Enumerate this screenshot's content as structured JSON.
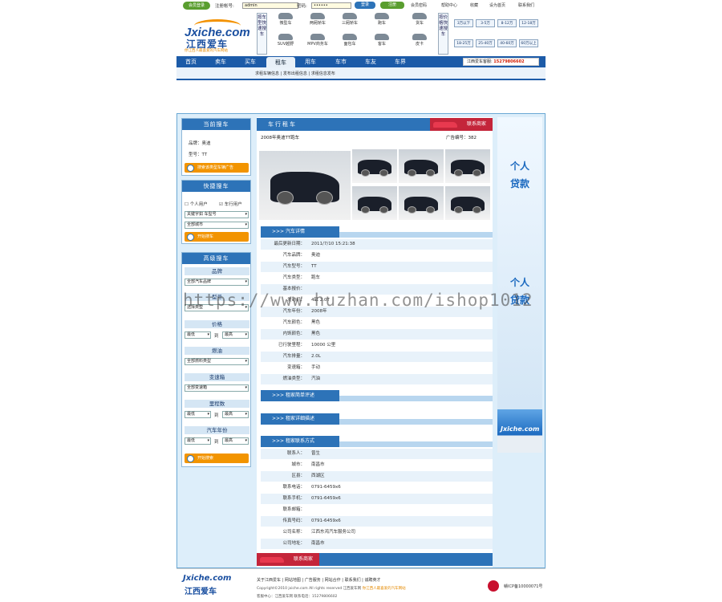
{
  "topbar": {
    "login_badge": "会员登录",
    "username_label": "注册帐号:",
    "username_value": "admin",
    "password_label": "密码:",
    "password_value": "••••••",
    "login_btn": "登录",
    "register_btn": "注册",
    "links": [
      "会员密码",
      "帮助中心",
      "收藏",
      "设为首页",
      "联系我们"
    ]
  },
  "header": {
    "logo_en": "Jxiche.com",
    "logo_cn": "江西爱车",
    "logo_sub": "你江西人最喜爱的汽车网站",
    "left_vtext": "按车型快速搜车",
    "right_vtext": "按价格快速搜车",
    "car_types": [
      "微型车",
      "两厢轿车",
      "三厢轿车",
      "跑车",
      "货车",
      "SUV越野",
      "MPV商务车",
      "面包车",
      "客车",
      "皮卡"
    ],
    "price_ranges": [
      "3万以下",
      "3-5万",
      "8-12万",
      "12-18万",
      "18-25万",
      "25-40万",
      "40-60万",
      "60万以上"
    ]
  },
  "nav": {
    "items": [
      "首页",
      "卖车",
      "买车",
      "租车",
      "用车",
      "车市",
      "车友",
      "车界"
    ],
    "active_index": 3,
    "hotline_label": "江西爱车客服:",
    "hotline_number": "15279806602"
  },
  "subnav": {
    "text": "求租车辆信息 | 发布出租信息 | 求租信息发布"
  },
  "sidebar": {
    "current": {
      "title": "当前搜车",
      "brand": "品牌：奥迪",
      "model": "型号：TT",
      "button": "搜索该类型车辆广告"
    },
    "quick": {
      "title": "快捷搜车",
      "opt1": "个人用户",
      "opt2": "车行用户",
      "keyword": "关键字如 车型号",
      "city": "全部城市",
      "button": "开始搜车"
    },
    "advanced": {
      "title": "高级搜车",
      "brand_hd": "品牌",
      "brand_sel": "全部汽车品牌",
      "model_hd": "型号",
      "model_sel": "选择类型",
      "price_hd": "价格",
      "low": "最低",
      "to": "到",
      "high": "最高",
      "fuel_hd": "燃油",
      "fuel_sel": "全部燃料类型",
      "gear_hd": "变速箱",
      "gear_sel": "全部变速箱",
      "mileage_hd": "里程数",
      "year_hd": "汽车年份",
      "button": "开始搜索"
    }
  },
  "center": {
    "title": "车行租车",
    "contact_btn": "联系商家",
    "ad_title": "2008年奥迪TT跑车",
    "ad_no": "广告编号：382",
    "detail_tab": "汽车详情",
    "details": [
      {
        "k": "最后更新日期：",
        "v": "2011/7/10 15:21:38"
      },
      {
        "k": "汽车品牌：",
        "v": "奥迪"
      },
      {
        "k": "汽车型号：",
        "v": "TT"
      },
      {
        "k": "汽车类型：",
        "v": "跑车"
      },
      {
        "k": "基本报价：",
        "v": ""
      },
      {
        "k": "发动机：",
        "v": "4缸 2.0T"
      },
      {
        "k": "汽车年份：",
        "v": "2008年"
      },
      {
        "k": "汽车颜色：",
        "v": "黑色"
      },
      {
        "k": "内饰颜色：",
        "v": "黑色"
      },
      {
        "k": "已行驶里程：",
        "v": "10000 公里"
      },
      {
        "k": "汽车排量：",
        "v": "2.0L"
      },
      {
        "k": "变速箱：",
        "v": "手动"
      },
      {
        "k": "燃油类型：",
        "v": "汽油"
      }
    ],
    "tab_short": "租家简单评述",
    "tab_long": "租家详细描述",
    "tab_contact": "租家联系方式",
    "contacts": [
      {
        "k": "联系人：",
        "v": "曾生"
      },
      {
        "k": "城市：",
        "v": "南昌市"
      },
      {
        "k": "区县：",
        "v": "西湖区"
      },
      {
        "k": "联系电话：",
        "v": "0791-6459x6"
      },
      {
        "k": "联系手机：",
        "v": "0791-6459x6"
      },
      {
        "k": "联系邮箱：",
        "v": ""
      },
      {
        "k": "传真号码：",
        "v": "0791-6459x6"
      },
      {
        "k": "公司名称：",
        "v": "江西东鸿汽车服务公司"
      },
      {
        "k": "公司地址：",
        "v": "南昌市"
      }
    ],
    "bottom_contact": "联系商家",
    "watermark_text": "https://www.huzhan.com/ishop1012"
  },
  "ad": {
    "text1": "个人贷款",
    "text2": "个人贷款",
    "logo": "Jxiche.com"
  },
  "footer": {
    "links": [
      "关于江西爱车",
      "网站地图",
      "广告服务",
      "网站合作",
      "联系我们",
      "诚聘英才"
    ],
    "line1": "Copyright©2010 jxiche.com All rights reserved 江西爱车网",
    "slogan": "你江西人最喜爱的汽车网站",
    "line2": "客服中心：江西爱车网 联系电话：15279806602",
    "icp": "赣ICP备10000071号",
    "logo_en": "Jxiche.com",
    "logo_cn": "江西爱车"
  }
}
